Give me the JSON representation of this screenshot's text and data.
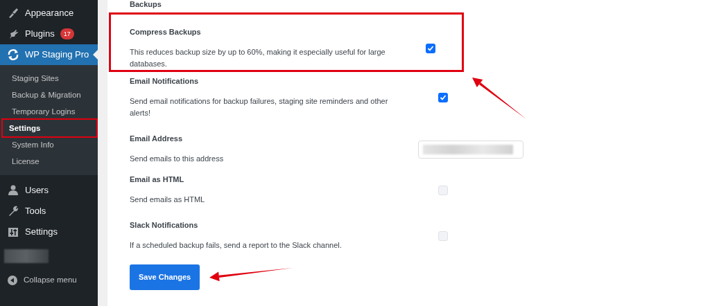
{
  "sidebar": {
    "menu_top": [
      {
        "label": "Appearance",
        "selected": false
      },
      {
        "label": "Plugins",
        "badge": "17",
        "selected": false
      },
      {
        "label": "WP Staging Pro",
        "selected": true
      }
    ],
    "submenu": [
      {
        "label": "Staging Sites",
        "selected": false,
        "highlighted": false
      },
      {
        "label": "Backup & Migration",
        "selected": false,
        "highlighted": false
      },
      {
        "label": "Temporary Logins",
        "selected": false,
        "highlighted": false
      },
      {
        "label": "Settings",
        "selected": true,
        "highlighted": true
      },
      {
        "label": "System Info",
        "selected": false,
        "highlighted": false
      },
      {
        "label": "License",
        "selected": false,
        "highlighted": false
      }
    ],
    "menu_bottom": [
      {
        "label": "Users",
        "selected": false
      },
      {
        "label": "Tools",
        "selected": false
      },
      {
        "label": "Settings",
        "selected": false
      }
    ],
    "collapse": {
      "label": "Collapse menu"
    }
  },
  "section_title": "Backups",
  "settings": [
    {
      "kind": "checkbox",
      "label": "Compress Backups",
      "description": "This reduces backup size by up to 60%, making it especially useful for large databases.",
      "checked": true,
      "highlighted": true
    },
    {
      "kind": "checkbox",
      "label": "Email Notifications",
      "description": "Send email notifications for backup failures, staging site reminders and other alerts!",
      "checked": true,
      "highlighted": false
    },
    {
      "kind": "text",
      "label": "Email Address",
      "description": "Send emails to this address",
      "highlighted": false
    },
    {
      "kind": "checkbox",
      "label": "Email as HTML",
      "description": "Send emails as HTML",
      "checked": false,
      "highlighted": false
    },
    {
      "kind": "checkbox",
      "label": "Slack Notifications",
      "description": "If a scheduled backup fails, send a report to the Slack channel.",
      "checked": false,
      "highlighted": false
    }
  ],
  "save_button": {
    "label": "Save Changes"
  },
  "annotations": [
    {
      "kind": "arrow"
    },
    {
      "kind": "arrow"
    }
  ]
}
